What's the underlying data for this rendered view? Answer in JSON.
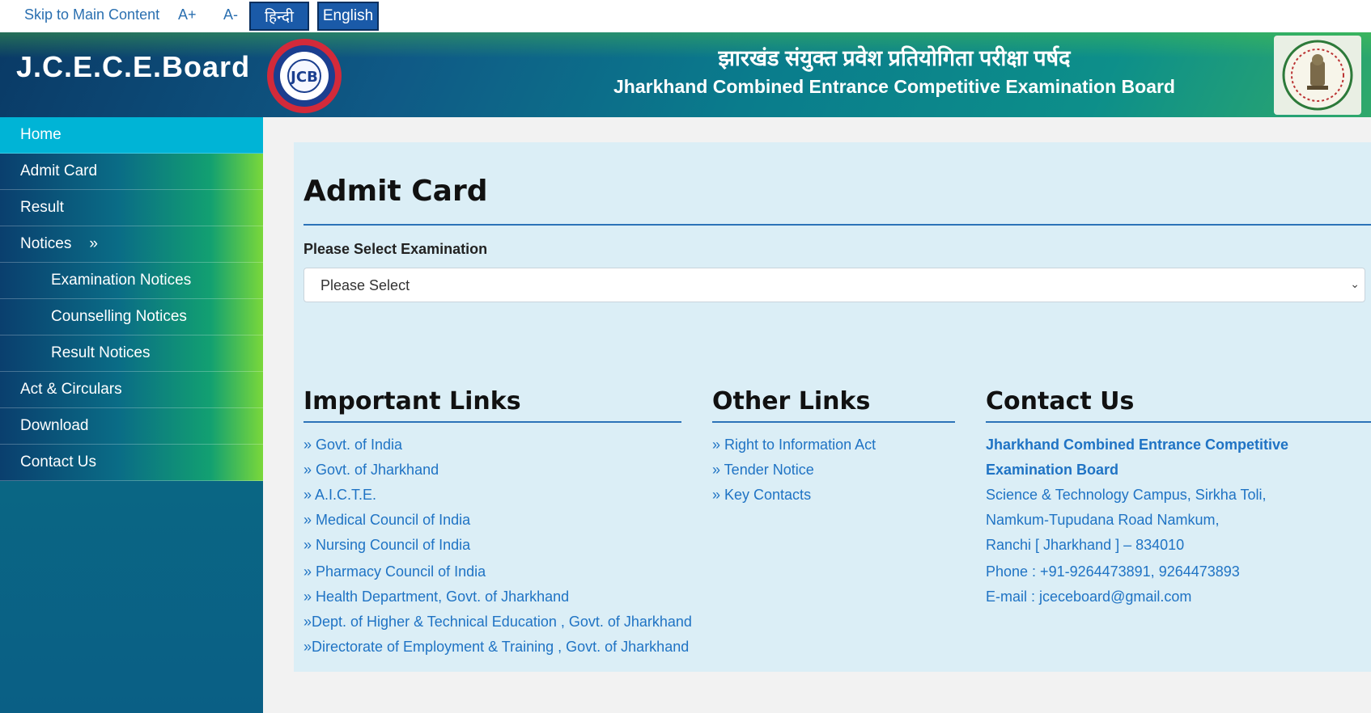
{
  "topbar": {
    "skip": "Skip to Main Content",
    "a_plus": "A+",
    "a_minus": "A-",
    "hindi": "हिन्दी",
    "english": "English"
  },
  "header": {
    "brand": "J.C.E.C.E.Board",
    "title_hindi": "झारखंड संयुक्त प्रवेश प्रतियोगिता परीक्षा पर्षद",
    "title_english": "Jharkhand Combined Entrance Competitive Examination Board",
    "logo_text": "JCB"
  },
  "sidebar": {
    "items": [
      {
        "label": "Home"
      },
      {
        "label": "Admit Card"
      },
      {
        "label": "Result"
      },
      {
        "label": "Notices",
        "arrow": "»"
      },
      {
        "label": "Examination Notices"
      },
      {
        "label": "Counselling Notices"
      },
      {
        "label": "Result Notices"
      },
      {
        "label": "Act & Circulars"
      },
      {
        "label": "Download"
      },
      {
        "label": "Contact Us"
      }
    ]
  },
  "main": {
    "title": "Admit Card",
    "select_label": "Please Select Examination",
    "select_value": "Please Select"
  },
  "important_links": {
    "title": "Important Links",
    "items": [
      "» Govt. of India",
      "» Govt. of Jharkhand",
      "» A.I.C.T.E.",
      "» Medical Council of India",
      "» Nursing Council of India",
      "» Pharmacy Council of India",
      "» Health Department, Govt. of Jharkhand",
      "»Dept. of Higher & Technical Education , Govt. of Jharkhand",
      "»Directorate of Employment & Training , Govt. of Jharkhand"
    ]
  },
  "other_links": {
    "title": "Other Links",
    "items": [
      "» Right to Information Act",
      "» Tender Notice",
      "» Key Contacts"
    ]
  },
  "contact": {
    "title": "Contact Us",
    "org_line1": "Jharkhand Combined Entrance Competitive",
    "org_line2": "Examination Board",
    "address1": "Science & Technology Campus, Sirkha Toli,",
    "address2": "Namkum-Tupudana Road Namkum,",
    "address3": "Ranchi [ Jharkhand ] – 834010",
    "phone": "Phone : +91-9264473891, 9264473893",
    "email": "E-mail : jceceboard@gmail.com"
  }
}
